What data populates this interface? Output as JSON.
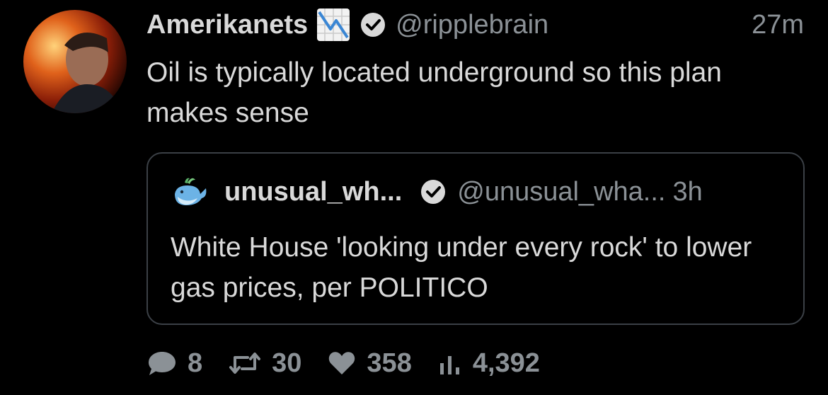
{
  "tweet": {
    "display_name": "Amerikanets",
    "name_emoji": "chart-decreasing-icon",
    "handle": "@ripplebrain",
    "time": "27m",
    "text": "Oil is typically located underground so this plan makes sense"
  },
  "quote": {
    "display_name": "unusual_wh...",
    "handle": "@unusual_wha...",
    "time": "3h",
    "text": "White House 'looking under every rock' to lower gas prices, per POLITICO"
  },
  "actions": {
    "replies": "8",
    "retweets": "30",
    "likes": "358",
    "views": "4,392"
  },
  "colors": {
    "background": "#000000",
    "primary_text": "#d9d9d9",
    "secondary_text": "#8b9196",
    "border": "#3b4046"
  }
}
